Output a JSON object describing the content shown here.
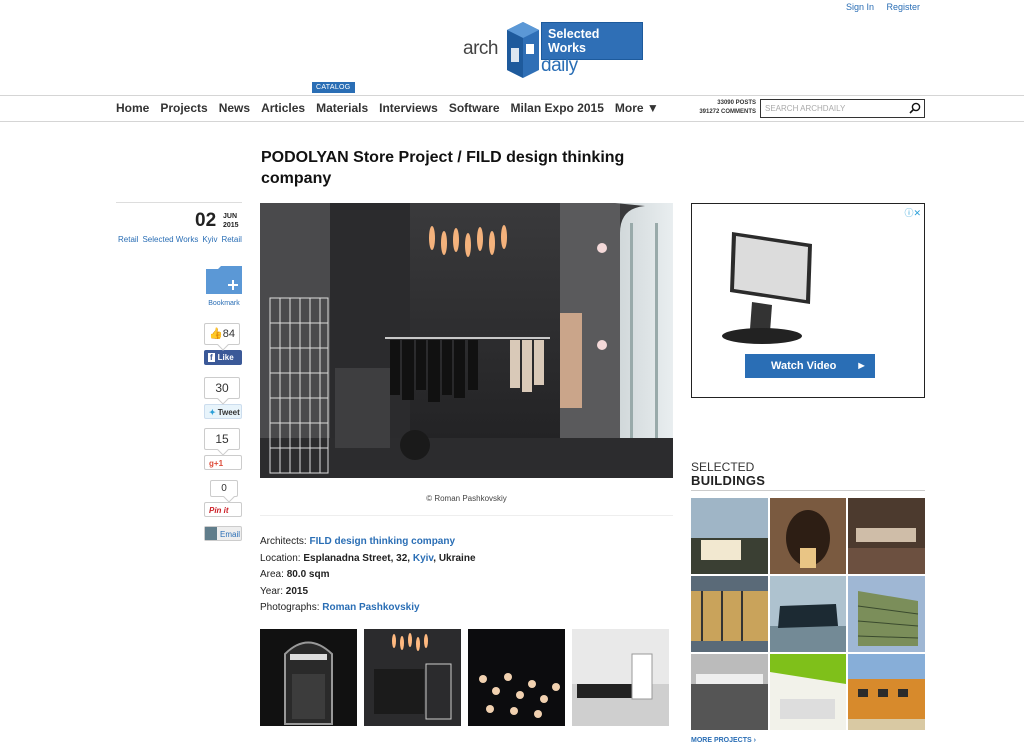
{
  "account": {
    "sign_in": "Sign In",
    "register": "Register"
  },
  "logo": {
    "left_text": "arch",
    "right_text": "daily",
    "bubble": "Selected Works"
  },
  "nav": {
    "items": [
      "Home",
      "Projects",
      "News",
      "Articles",
      "Materials",
      "Interviews",
      "Software",
      "Milan Expo 2015",
      "More ▼"
    ],
    "catalog_badge": "CATALOG",
    "posts_count": "33090 POSTS",
    "comments_count": "391272 COMMENTS",
    "search_placeholder": "SEARCH ARCHDAILY"
  },
  "article": {
    "title": "PODOLYAN Store Project / FILD design thinking company",
    "day": "02",
    "month": "JUN",
    "year": "2015",
    "tags": [
      "Retail",
      "Selected Works",
      "Kyiv",
      "Retail"
    ],
    "bookmark_label": "Bookmark",
    "caption": "© Roman Pashkovskiy",
    "facts": {
      "architects_label": "Architects:",
      "architects_value": "FILD design thinking company",
      "location_label": "Location:",
      "location_street": "Esplanadna Street, 32,",
      "location_city": "Kyiv",
      "location_country": ", Ukraine",
      "area_label": "Area:",
      "area_value": "80.0 sqm",
      "year_label": "Year:",
      "year_value": "2015",
      "photos_label": "Photographs:",
      "photos_value": "Roman Pashkovskiy"
    }
  },
  "social": {
    "fb_count": "84",
    "fb_label": "Like",
    "tweet_count": "30",
    "tweet_label": "Tweet",
    "gplus_count": "15",
    "gplus_label": "+1",
    "pin_count": "0",
    "pin_label": "Pin it",
    "email_label": "Email"
  },
  "ad": {
    "button": "Watch Video"
  },
  "sidebar": {
    "heading_light": "SELECTED",
    "heading_bold": "BUILDINGS",
    "more_link": "MORE PROJECTS ›"
  },
  "colors": {
    "link_blue": "#2a6eb5",
    "facebook": "#3b5998",
    "twitter": "#2a9fd8",
    "google": "#dd4b39",
    "pinterest": "#cb2027"
  }
}
